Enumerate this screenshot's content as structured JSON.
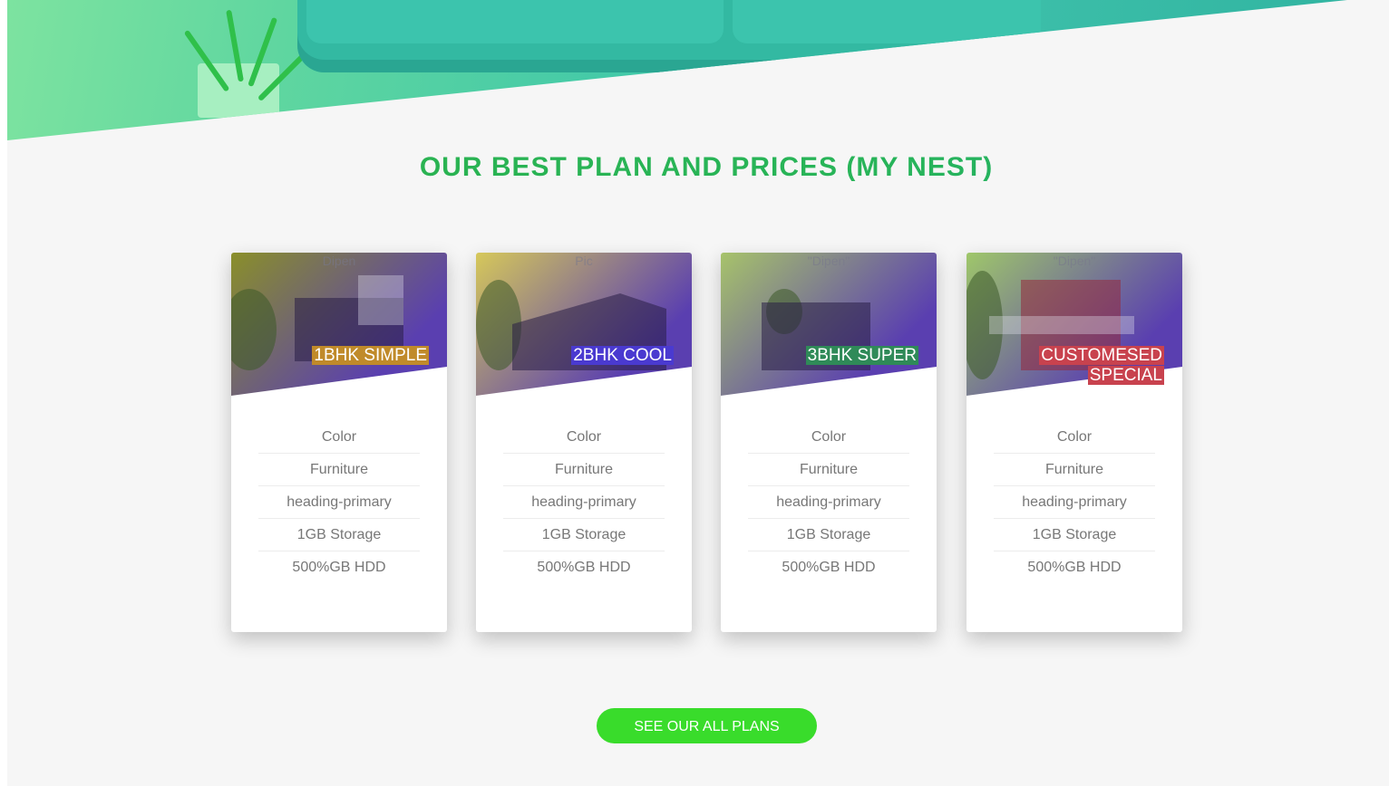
{
  "section": {
    "title": "OUR BEST PLAN AND PRICES (MY NEST)"
  },
  "cards": [
    {
      "alt": "Dipen",
      "badge_lines": [
        "1BHK SIMPLE"
      ],
      "badge_color": "#c08a2a",
      "image_tint": [
        "#8a8f2a",
        "#5a3fb0"
      ],
      "features": [
        "Color",
        "Furniture",
        "heading-primary",
        "1GB Storage",
        "500%GB HDD"
      ]
    },
    {
      "alt": "Pic",
      "badge_lines": [
        "2BHK COOL"
      ],
      "badge_color": "#4a3ad0",
      "image_tint": [
        "#d6c85a",
        "#5a3fb0"
      ],
      "features": [
        "Color",
        "Furniture",
        "heading-primary",
        "1GB Storage",
        "500%GB HDD"
      ]
    },
    {
      "alt": "\"Dipen\"",
      "badge_lines": [
        "3BHK SUPER"
      ],
      "badge_color": "#2f8a58",
      "image_tint": [
        "#a7c36a",
        "#5a3fb0"
      ],
      "features": [
        "Color",
        "Furniture",
        "heading-primary",
        "1GB Storage",
        "500%GB HDD"
      ]
    },
    {
      "alt": "\"Dipen\"",
      "badge_lines": [
        "CUSTOMESED",
        "SPECIAL"
      ],
      "badge_color": "#c8424e",
      "image_tint": [
        "#9fc76a",
        "#5a3fb0"
      ],
      "features": [
        "Color",
        "Furniture",
        "heading-primary",
        "1GB Storage",
        "500%GB HDD"
      ]
    }
  ],
  "cta": {
    "label": "SEE OUR ALL PLANS",
    "color": "#39dc2b"
  }
}
